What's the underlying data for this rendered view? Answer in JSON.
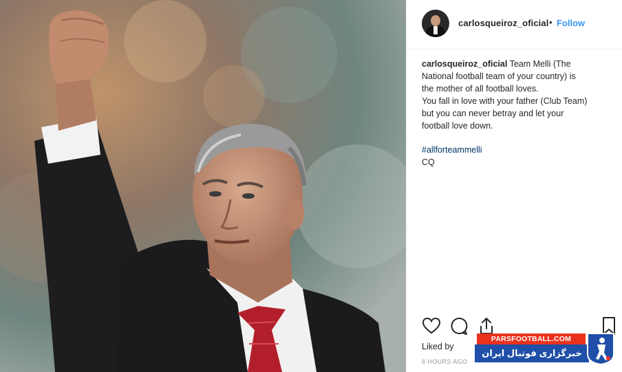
{
  "post": {
    "username": "carlosqueiroz_oficial",
    "separator": "•",
    "follow_label": "Follow",
    "caption": {
      "username": "carlosqueiroz_oficial",
      "line1": "Team Melli (The",
      "line2": "National football team of your country) is",
      "line3": "the mother of all football loves.",
      "line4": "You fall in love with your father (Club Team)",
      "line5": "but you can never betray and let your",
      "line6": "football love down.",
      "hashtag": "#allforteammelli",
      "signature": "CQ"
    },
    "liked_by_label": "Liked by",
    "time_ago": "6 HOURS AGO"
  },
  "icons": [
    "heart-icon",
    "comment-icon",
    "share-icon",
    "bookmark-icon"
  ],
  "watermark": {
    "site": "PARSFOOTBALL.COM",
    "tagline": "خبرگزاری فوتبال ایران"
  },
  "colors": {
    "follow_blue": "#3897f0",
    "hashtag_blue": "#003569",
    "watermark_red": "#e8321e",
    "watermark_blue": "#1f4fa8"
  }
}
